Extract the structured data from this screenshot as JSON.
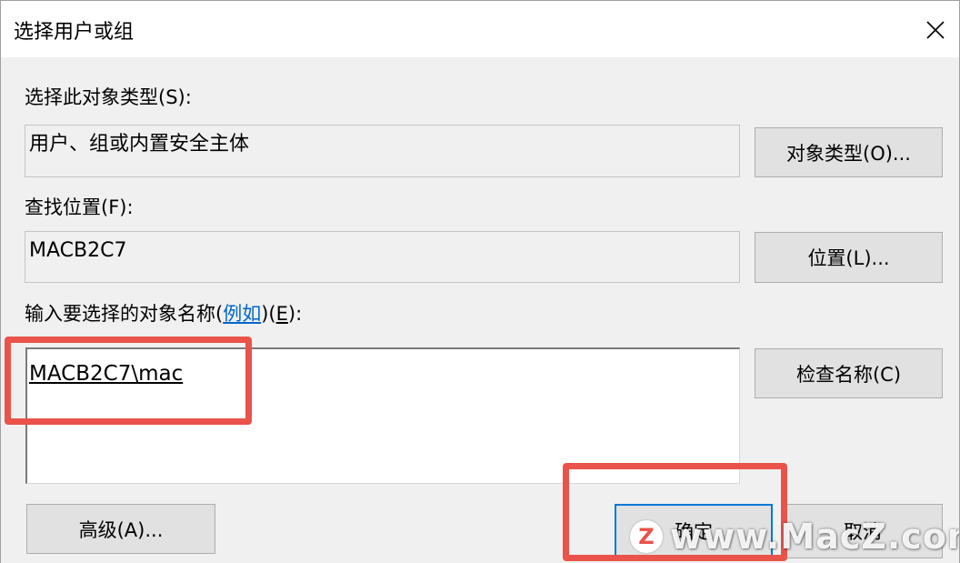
{
  "window": {
    "title": "选择用户或组",
    "close_icon": "close-icon"
  },
  "object_type": {
    "label": "选择此对象类型(S):",
    "value": "用户、组或内置安全主体",
    "button": "对象类型(O)..."
  },
  "location": {
    "label": "查找位置(F):",
    "value": "MACB2C7",
    "button": "位置(L)..."
  },
  "names": {
    "label_prefix": "输入要选择的对象名称(",
    "label_link": "例如",
    "label_mid": ")(",
    "label_key": "E",
    "label_suffix": "):",
    "value": "MACB2C7\\mac",
    "check_button": "检查名称(C)"
  },
  "footer": {
    "advanced_button": "高级(A)...",
    "ok_button": "确定",
    "cancel_button": "取消"
  },
  "watermark": {
    "logo_letter": "Z",
    "text": "www.MacZ.com"
  },
  "colors": {
    "highlight": "#e9534a",
    "link": "#0066cc",
    "focus_border": "#0078d7"
  }
}
